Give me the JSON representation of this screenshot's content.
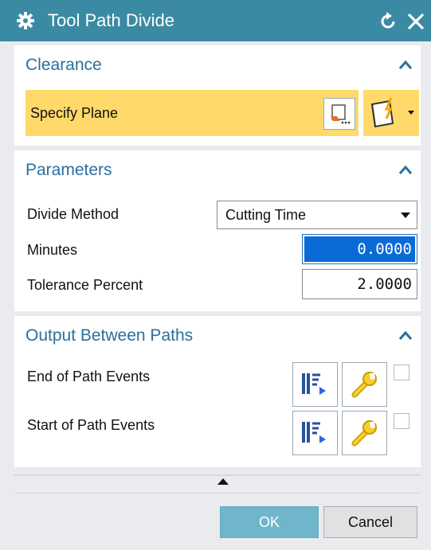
{
  "window": {
    "title": "Tool Path Divide"
  },
  "clearance": {
    "title": "Clearance",
    "specify_plane_label": "Specify Plane"
  },
  "parameters": {
    "title": "Parameters",
    "divide_method_label": "Divide Method",
    "divide_method_value": "Cutting Time",
    "minutes_label": "Minutes",
    "minutes_value": "0.0000",
    "tolerance_label": "Tolerance Percent",
    "tolerance_value": "2.0000"
  },
  "output": {
    "title": "Output Between Paths",
    "end_events_label": "End of Path Events",
    "start_events_label": "Start of Path Events"
  },
  "footer": {
    "ok_label": "OK",
    "cancel_label": "Cancel"
  },
  "colors": {
    "titlebar": "#3b8aa3",
    "section_title": "#2a6f9c",
    "highlight_row": "#ffd969",
    "selection": "#0a6bd6",
    "ok_button": "#6fb6cc"
  }
}
